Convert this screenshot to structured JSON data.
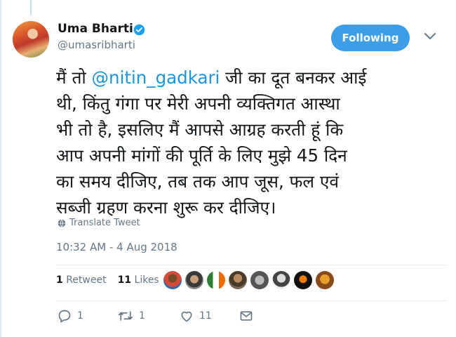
{
  "author": {
    "name": "Uma Bharti",
    "handle": "@umasribharti"
  },
  "follow_button": {
    "label": "Following"
  },
  "tweet": {
    "lines": [
      {
        "pre": "मैं तो ",
        "mention": "@nitin_gadkari",
        "post": " जी का दूत बनकर आई"
      },
      {
        "text": "थी, किंतु गंगा पर मेरी अपनी व्यक्तिगत आस्था"
      },
      {
        "text": "भी तो है, इसलिए मैं आपसे आग्रह करती हूं कि"
      },
      {
        "text": "आप अपनी मांगों की पूर्ति के लिए मुझे 45 दिन"
      },
      {
        "text": "का समय दीजिए, तब तक आप जूस, फल एवं"
      },
      {
        "text": "सब्जी ग्रहण करना शुरू कर दीजिए।"
      }
    ],
    "translate_label": "Translate Tweet",
    "timestamp": "10:32 AM - 4 Aug 2018"
  },
  "stats": {
    "retweets_count": "1",
    "retweets_label": "Retweet",
    "likes_count": "11",
    "likes_label": "Likes"
  },
  "actions": {
    "reply_count": "1",
    "retweet_count": "1",
    "like_count": "11"
  },
  "colors": {
    "accent": "#1b95e0",
    "button": "#3d9ee8",
    "muted": "#657786"
  }
}
